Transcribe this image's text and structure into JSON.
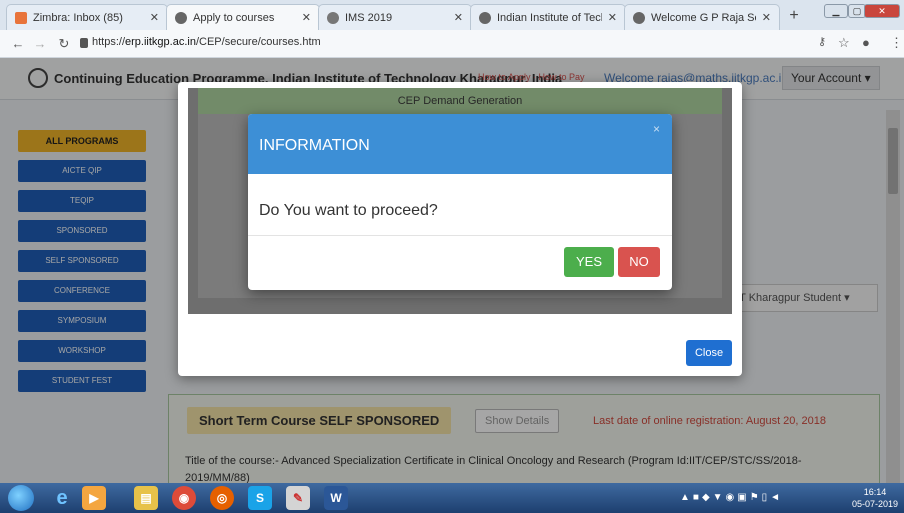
{
  "browser": {
    "tabs": [
      {
        "title": "Zimbra: Inbox (85)",
        "icon": "zimbra-icon",
        "color": "#e8743b"
      },
      {
        "title": "Apply to courses",
        "icon": "iit-logo-icon",
        "color": "#555555"
      },
      {
        "title": "IMS 2019",
        "icon": "globe-icon",
        "color": "#555555"
      },
      {
        "title": "Indian Institute of Technolo...",
        "icon": "iit-logo-icon",
        "color": "#555555"
      },
      {
        "title": "Welcome G P Raja Sekhar",
        "icon": "iit-logo-icon",
        "color": "#555555"
      }
    ],
    "url_prefix": "https://",
    "url_host": "erp.iitkgp.ac.in",
    "url_path": "/CEP/secure/courses.htm"
  },
  "header": {
    "brand": "Continuing Education Programme, Indian Institute of Technology Kharagpur, India",
    "links": "How to Apply · How to Pay",
    "welcome": "Welcome rajas@maths.iitkgp.ac.in",
    "account_label": "Your Account"
  },
  "sidebar": {
    "items": [
      {
        "label": "ALL PROGRAMS",
        "active": true
      },
      {
        "label": "AICTE QIP"
      },
      {
        "label": "TEQIP"
      },
      {
        "label": "SPONSORED"
      },
      {
        "label": "SELF SPONSORED"
      },
      {
        "label": "CONFERENCE"
      },
      {
        "label": "SYMPOSIUM"
      },
      {
        "label": "WORKSHOP"
      },
      {
        "label": "STUDENT FEST"
      }
    ]
  },
  "background_select": {
    "value": "IIT Kharagpur Student"
  },
  "course": {
    "title": "Short Term Course SELF SPONSORED",
    "show_details": "Show Details",
    "last_date": "Last date of online registration: August 20, 2018",
    "description": "Title of the course:- Advanced Specialization Certificate in Clinical Oncology and Research (Program Id:IIT/CEP/STC/SS/2018-2019/MM/88)"
  },
  "outer_modal": {
    "header": "CEP Demand Generation",
    "close_label": "Close"
  },
  "info_modal": {
    "title": "INFORMATION",
    "message": "Do You want to proceed?",
    "yes_label": "YES",
    "no_label": "NO",
    "close_glyph": "×"
  },
  "taskbar": {
    "time": "16:14",
    "date": "05-07-2019"
  },
  "colors": {
    "accent": "#3d8fd6",
    "yes": "#4cae4c",
    "no": "#d9534f",
    "sidebar": "#1f5fb8",
    "sidebar_active": "#f0b429"
  }
}
